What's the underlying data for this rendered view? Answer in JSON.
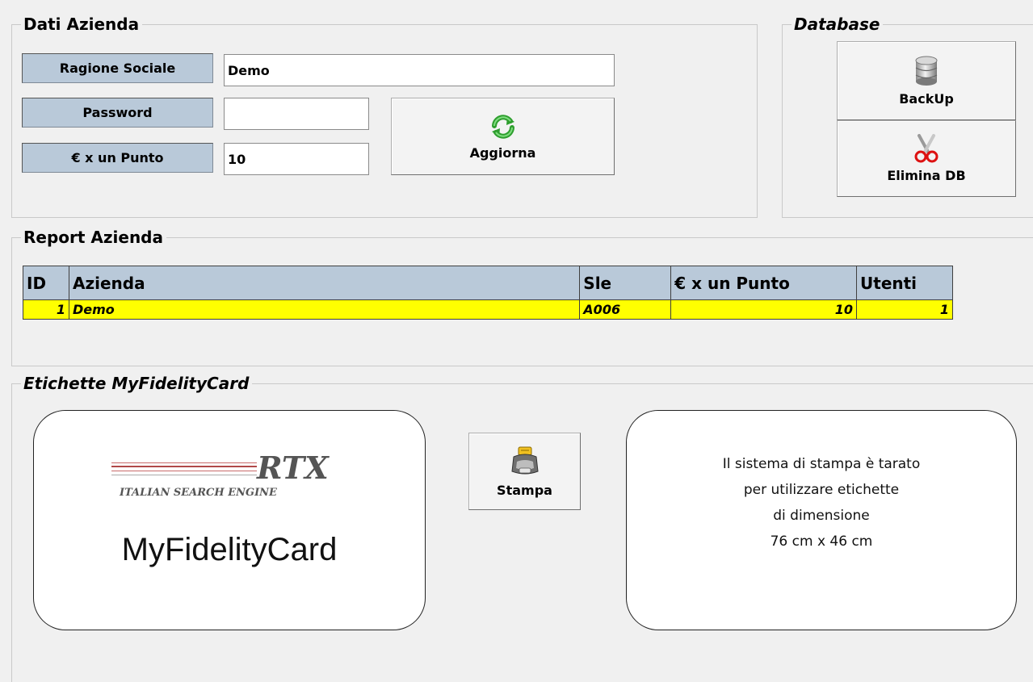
{
  "dati_azienda": {
    "title": "Dati Azienda",
    "ragione_sociale_label": "Ragione Sociale",
    "ragione_sociale_value": "Demo",
    "password_label": "Password",
    "password_value": "",
    "euro_punto_label": "€ x un Punto",
    "euro_punto_value": "10",
    "aggiorna_label": "Aggiorna"
  },
  "database": {
    "title": "Database",
    "backup_label": "BackUp",
    "elimina_label": "Elimina DB"
  },
  "report": {
    "title": "Report Azienda",
    "columns": [
      "ID",
      "Azienda",
      "Sle",
      "€ x un Punto",
      "Utenti"
    ],
    "rows": [
      {
        "id": "1",
        "azienda": "Demo",
        "sle": "A006",
        "euro_punto": "10",
        "utenti": "1"
      }
    ]
  },
  "etichette": {
    "title": "Etichette MyFidelityCard",
    "logo_text": "RTX",
    "logo_subtitle": "ITALIAN SEARCH ENGINE",
    "card_title": "MyFidelityCard",
    "stampa_label": "Stampa",
    "info_lines": [
      "Il sistema di stampa è tarato",
      "per utilizzare etichette",
      "di dimensione",
      "76 cm x 46 cm"
    ]
  },
  "icons": {
    "refresh": "refresh-icon",
    "database": "database-icon",
    "scissors": "scissors-icon",
    "printer": "printer-icon"
  },
  "colors": {
    "label_bg": "#b9c9d9",
    "row_highlight": "#ffff00",
    "refresh_green": "#2e9e2e"
  }
}
